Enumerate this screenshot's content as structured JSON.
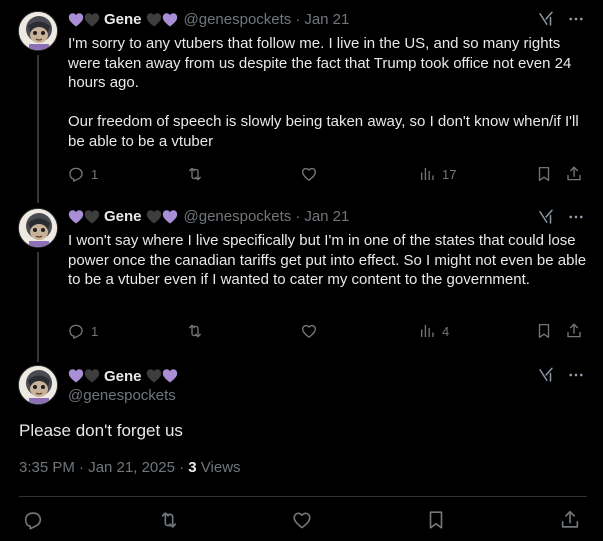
{
  "tweets": [
    {
      "name": "Gene",
      "handle": "@genespockets",
      "date": "Jan 21",
      "text": "I'm sorry to any vtubers that follow me. I live in the US, and so many rights were taken away from us despite the fact that Trump took office not even 24 hours ago.\n\nOur freedom of speech is slowly being taken away, so I don't know when/if I'll be able to be a vtuber",
      "replies": "1",
      "views": "17"
    },
    {
      "name": "Gene",
      "handle": "@genespockets",
      "date": "Jan 21",
      "text": "I won't say where I live specifically but I'm in one of the states that could lose power once the canadian tariffs get put into effect. So I might not even be able to be a vtuber even if I wanted to cater my content to the government.",
      "replies": "1",
      "views": "4"
    }
  ],
  "main": {
    "name": "Gene",
    "handle": "@genespockets",
    "text": "Please don't forget us",
    "time": "3:35 PM · Jan 21, 2025",
    "sep": "·",
    "views_count": "3",
    "views_label": "Views"
  },
  "colors": {
    "purple_heart": "#aa8ed6",
    "black_heart": "#3d3d3d",
    "muted": "#71767b",
    "text": "#e7e9ea"
  },
  "icons": [
    "reply-icon",
    "retweet-icon",
    "like-icon",
    "views-icon",
    "bookmark-icon",
    "share-icon",
    "grok-icon",
    "more-icon"
  ]
}
